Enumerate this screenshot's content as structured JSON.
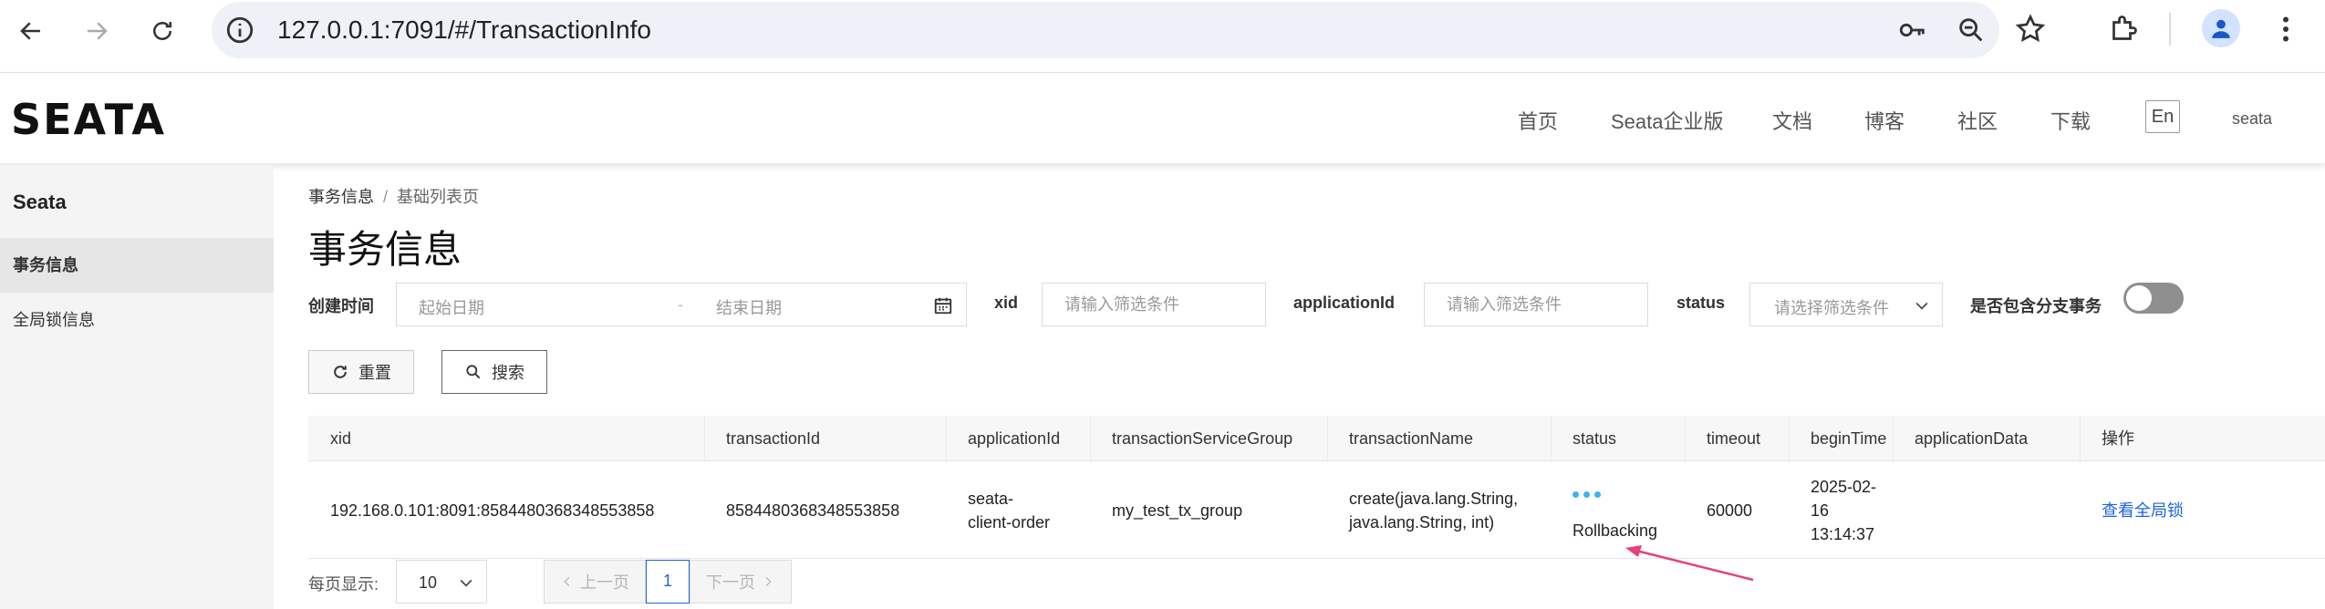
{
  "browser": {
    "url": "127.0.0.1:7091/#/TransactionInfo",
    "icons": [
      "back-arrow-icon",
      "forward-arrow-icon",
      "reload-icon",
      "site-info-icon",
      "password-key-icon",
      "zoom-icon",
      "bookmark-star-icon",
      "extensions-puzzle-icon",
      "profile-icon",
      "menu-dots-icon"
    ]
  },
  "header": {
    "logo": "SEATA",
    "nav": [
      "首页",
      "Seata企业版",
      "文档",
      "博客",
      "社区",
      "下载"
    ],
    "lang": "En",
    "user": "seata"
  },
  "sidebar": {
    "title": "Seata",
    "items": [
      {
        "label": "事务信息",
        "active": true
      },
      {
        "label": "全局锁信息",
        "active": false
      }
    ]
  },
  "breadcrumb": {
    "first": "事务信息",
    "separator": "/",
    "second": "基础列表页"
  },
  "page_title": "事务信息",
  "filters": {
    "create_time_label": "创建时间",
    "start_placeholder": "起始日期",
    "range_dash": "-",
    "end_placeholder": "结束日期",
    "xid_label": "xid",
    "xid_placeholder": "请输入筛选条件",
    "app_label": "applicationId",
    "app_placeholder": "请输入筛选条件",
    "status_label": "status",
    "status_placeholder": "请选择筛选条件",
    "branch_label": "是否包含分支事务",
    "branch_toggle_on": false
  },
  "buttons": {
    "reset": "重置",
    "search": "搜索"
  },
  "table": {
    "columns": [
      "xid",
      "transactionId",
      "applicationId",
      "transactionServiceGroup",
      "transactionName",
      "status",
      "timeout",
      "beginTime",
      "applicationData",
      "操作"
    ],
    "rows": [
      {
        "xid": "192.168.0.101:8091:8584480368348553858",
        "transactionId": "8584480368348553858",
        "applicationId_l1": "seata-",
        "applicationId_l2": "client-order",
        "transactionServiceGroup": "my_test_tx_group",
        "transactionName_l1": "create(java.lang.String,",
        "transactionName_l2": "java.lang.String, int)",
        "status": "Rollbacking",
        "timeout": "60000",
        "beginTime_l1": "2025-02-",
        "beginTime_l2": "16",
        "beginTime_l3": "13:14:37",
        "applicationData": "",
        "action": "查看全局锁"
      }
    ]
  },
  "pagination": {
    "page_size_label": "每页显示:",
    "page_size": "10",
    "prev": "上一页",
    "current": "1",
    "next": "下一页"
  },
  "colors": {
    "accent": "#1f64dc",
    "status_dots": "#3ab4f2",
    "annotation_arrow": "#e8407a"
  }
}
